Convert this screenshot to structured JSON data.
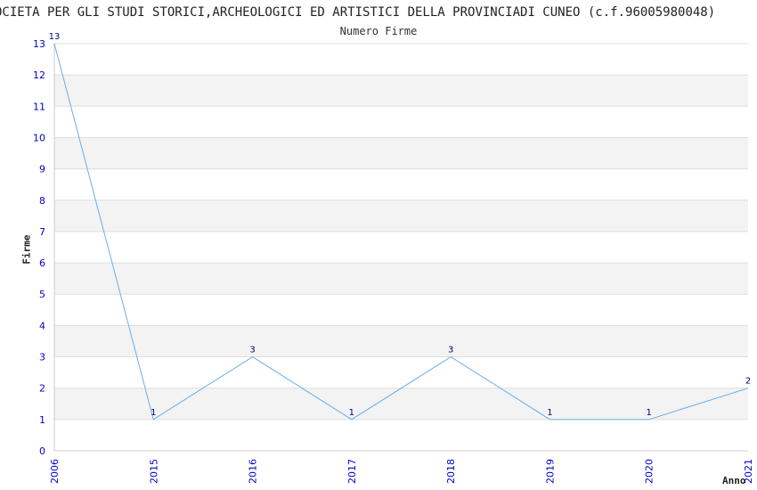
{
  "chart_data": {
    "type": "line",
    "title": "OCIETA PER GLI STUDI STORICI,ARCHEOLOGICI ED ARTISTICI DELLA PROVINCIADI CUNEO (c.f.96005980048)",
    "subtitle": "Numero Firme",
    "xlabel": "Anno",
    "ylabel": "Firme",
    "x": [
      "2006",
      "2015",
      "2016",
      "2017",
      "2018",
      "2019",
      "2020",
      "2021"
    ],
    "series": [
      {
        "values": [
          13,
          1,
          3,
          1,
          3,
          1,
          1,
          2
        ]
      }
    ],
    "ylim": [
      0,
      13
    ],
    "yticks": [
      0,
      1,
      2,
      3,
      4,
      5,
      6,
      7,
      8,
      9,
      10,
      11,
      12,
      13
    ],
    "grid": true,
    "line_color": "#6aaee8",
    "band_color": "#f3f3f3",
    "tick_color": "#0000cc"
  }
}
